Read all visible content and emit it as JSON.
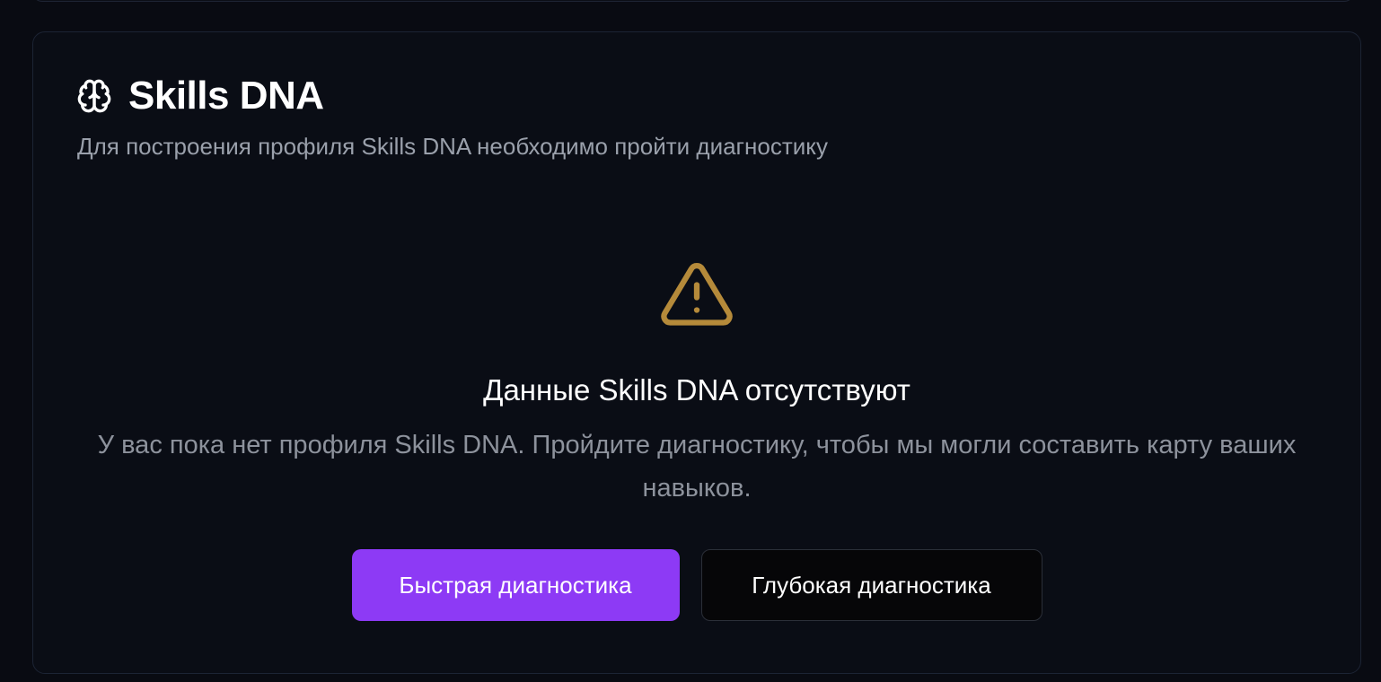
{
  "card": {
    "title": "Skills DNA",
    "subtitle": "Для построения профиля Skills DNA необходимо пройти диагностику",
    "title_icon": "brain-icon"
  },
  "empty_state": {
    "icon": "warning-triangle-icon",
    "icon_color": "#b58a3a",
    "title": "Данные Skills DNA отсутствуют",
    "description": "У вас пока нет профиля Skills DNA. Пройдите диагностику, чтобы мы могли составить карту ваших навыков."
  },
  "actions": {
    "quick_label": "Быстрая диагностика",
    "deep_label": "Глубокая диагностика",
    "primary_color": "#8d3af5"
  }
}
